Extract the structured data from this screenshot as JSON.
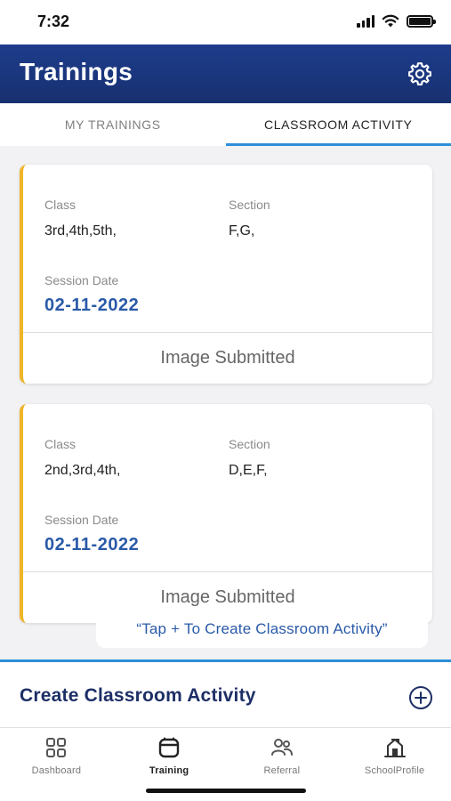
{
  "status_bar": {
    "time": "7:32",
    "icons": [
      "signal-icon",
      "wifi-icon",
      "battery-icon"
    ]
  },
  "header": {
    "title": "Trainings",
    "settings_icon": "gear-icon",
    "background": "#1e3c8c"
  },
  "tabs": [
    {
      "label": "MY TRAININGS",
      "active": false
    },
    {
      "label": "CLASSROOM ACTIVITY",
      "active": true
    }
  ],
  "activities": [
    {
      "class_label": "Class",
      "class_value": "3rd,4th,5th,",
      "section_label": "Section",
      "section_value": "F,G,",
      "date_label": "Session Date",
      "date_value": "02-11-2022",
      "status": "Image Submitted"
    },
    {
      "class_label": "Class",
      "class_value": "2nd,3rd,4th,",
      "section_label": "Section",
      "section_value": "D,E,F,",
      "date_label": "Session Date",
      "date_value": "02-11-2022",
      "status": "Image Submitted"
    }
  ],
  "tooltip": "“Tap + To Create Classroom Activity”",
  "create_activity": {
    "label": "Create Classroom Activity",
    "icon": "plus-circle-icon"
  },
  "bottom_nav": [
    {
      "label": "Dashboard",
      "icon": "dashboard-grid-icon",
      "active": false
    },
    {
      "label": "Training",
      "icon": "training-icon",
      "active": true
    },
    {
      "label": "Referral",
      "icon": "referral-people-icon",
      "active": false
    },
    {
      "label": "SchoolProfile",
      "icon": "school-icon",
      "active": false
    }
  ],
  "colors": {
    "accent": "#2e8fd8",
    "card_stripe": "#f0b429",
    "date_text": "#2a5aa8",
    "header": "#1e3c8c"
  }
}
